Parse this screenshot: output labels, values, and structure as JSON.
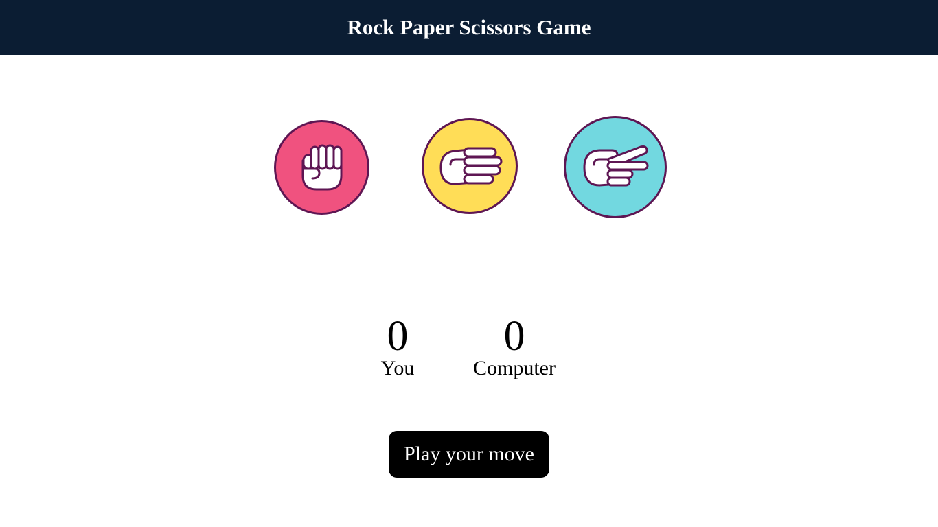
{
  "header": {
    "title": "Rock Paper Scissors Game"
  },
  "choices": [
    {
      "id": "rock",
      "icon": "fist-icon",
      "color": "#f0527f"
    },
    {
      "id": "paper",
      "icon": "flat-hand-icon",
      "color": "#ffdd57"
    },
    {
      "id": "scissors",
      "icon": "scissors-hand-icon",
      "color": "#72d8e0"
    }
  ],
  "score": {
    "you": {
      "value": "0",
      "label": "You"
    },
    "computer": {
      "value": "0",
      "label": "Computer"
    }
  },
  "play_button": {
    "label": "Play your move"
  },
  "colors": {
    "header_bg": "#0b1d33",
    "outline": "#5e1653",
    "button_bg": "#000000"
  }
}
